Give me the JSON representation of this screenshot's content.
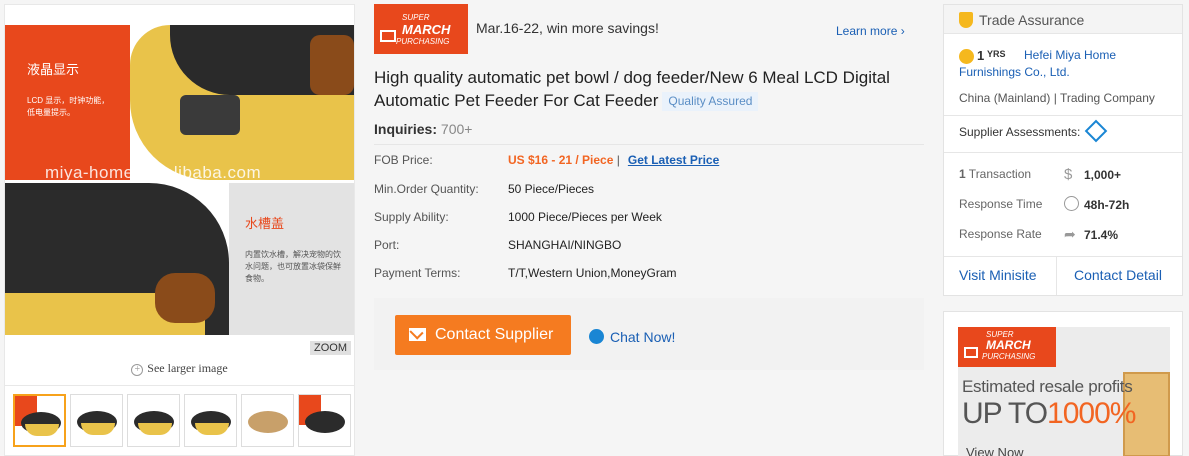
{
  "gallery": {
    "image_text": {
      "panel_red_title": "液晶显示",
      "panel_red_desc": "LCD 显示，时钟功能，低电量提示。",
      "panel_grey_title": "水槽盖",
      "panel_grey_desc": "内置饮水槽，解决宠物的饮水问题，也可放置冰袋保鲜食物。",
      "watermark": "miya-home.en.alibaba.com"
    },
    "zoom_label": "ZOOM",
    "see_larger": "See larger image",
    "thumbnails_count": 6,
    "selected_thumbnail": 1
  },
  "promo": {
    "badge_top": "SUPER",
    "badge_main": "MARCH",
    "badge_bottom": "PURCHASING",
    "text": "Mar.16-22, win more savings!",
    "learn_more": "Learn more"
  },
  "product": {
    "title": "High quality automatic pet bowl / dog feeder/New 6 Meal LCD Digital Automatic Pet Feeder For Cat Feeder",
    "quality_badge": "Quality Assured",
    "inquiries_label": "Inquiries:",
    "inquiries_value": "700+",
    "specs": {
      "fob_label": "FOB Price:",
      "fob_value": "US $16 - 21 / Piece",
      "latest_price": "Get Latest Price",
      "moq_label": "Min.Order Quantity:",
      "moq_value": "50 Piece/Pieces",
      "supply_label": "Supply Ability:",
      "supply_value": "1000 Piece/Pieces per Week",
      "port_label": "Port:",
      "port_value": "SHANGHAI/NINGBO",
      "payment_label": "Payment Terms:",
      "payment_value": "T/T,Western Union,MoneyGram"
    },
    "contact_button": "Contact Supplier",
    "chat_now": "Chat Now!"
  },
  "supplier": {
    "trade_assurance": "Trade Assurance",
    "years_num": "1",
    "years_unit": "YRS",
    "company": "Hefei Miya Home Furnishings Co., Ltd.",
    "location": "China (Mainland) | Trading Company",
    "assessments_label": "Supplier Assessments:",
    "transaction_count": "1",
    "transaction_label": " Transaction",
    "transaction_value": "1,000+",
    "response_time_label": "Response Time",
    "response_time_value": "48h-72h",
    "response_rate_label": "Response Rate",
    "response_rate_value": "71.4%",
    "visit_minisite": "Visit Minisite",
    "contact_detail": "Contact Detail"
  },
  "ad": {
    "badge_top": "SUPER",
    "badge_main": "MARCH",
    "badge_bottom": "PURCHASING",
    "estimated": "Estimated resale profits",
    "up_to": "UP TO",
    "percent": "1000%",
    "view_now": "View Now"
  },
  "colors": {
    "accent_orange": "#f57b20",
    "price_orange": "#f26522",
    "link_blue": "#1a5fb4",
    "promo_red": "#e8481c",
    "trade_gold": "#f5b81e"
  }
}
